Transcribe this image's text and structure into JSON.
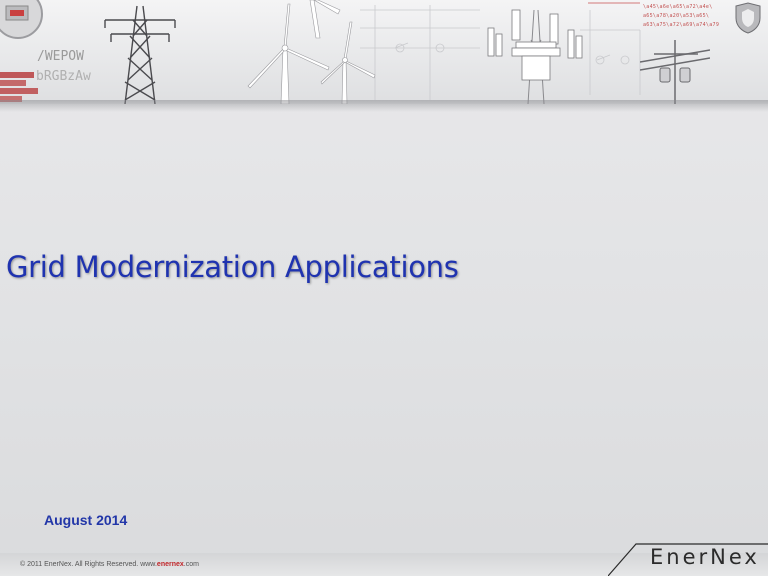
{
  "slide": {
    "title": "Grid Modernization Applications",
    "date": "August 2014"
  },
  "footer": {
    "copyright_prefix": "© 2011 EnerNex. All Rights Reserved. www.",
    "copyright_brand": "enernex",
    "copyright_suffix": ".com"
  },
  "logo": {
    "text": "EnerNex"
  },
  "banner": {
    "code_line_1": "/WEPOW",
    "code_line_2": "bRGBzAw",
    "meter_reading": "00",
    "hex_lines": [
      "\\a45\\a6e\\a65\\a72\\a4e\\",
      "a65\\a78\\a20\\a53\\a65\\",
      "a63\\a75\\a72\\a69\\a74\\a79"
    ]
  },
  "colors": {
    "title": "#1f33b0",
    "date": "#2236a8",
    "accent_red": "#c0262a"
  },
  "icons": [
    "electric-meter-icon",
    "power-pylon-icon",
    "wind-turbine-icon",
    "cell-tower-icon",
    "utility-pole-icon",
    "shield-icon"
  ]
}
